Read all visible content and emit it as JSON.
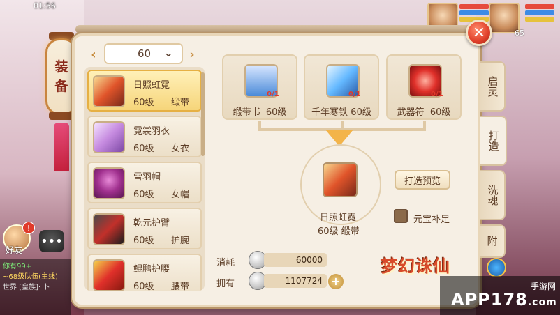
{
  "status": {
    "time": "01:56"
  },
  "hud": {
    "player_level": "65"
  },
  "lantern": {
    "title_chars": [
      "装",
      "备"
    ]
  },
  "left": {
    "friend_label": "好友",
    "friend_badge": "!",
    "chat_lines": [
      {
        "text": "你有99+",
        "color": "g"
      },
      {
        "text": "~68级队伍(主线)",
        "color": "y"
      },
      {
        "text": "世界 [皇族]· 卜",
        "color": "w"
      }
    ]
  },
  "level_select": {
    "value": "60"
  },
  "items": [
    {
      "name": "日照虹霓",
      "level": "60级",
      "type": "缎带",
      "selected": true,
      "icon": "ribbon-icon"
    },
    {
      "name": "霓裳羽衣",
      "level": "60级",
      "type": "女衣",
      "selected": false,
      "icon": "dress-icon"
    },
    {
      "name": "雪羽帽",
      "level": "60级",
      "type": "女帽",
      "selected": false,
      "icon": "hat-icon"
    },
    {
      "name": "乾元护臂",
      "level": "60级",
      "type": "护腕",
      "selected": false,
      "icon": "bracer-icon"
    },
    {
      "name": "鲲鹏护腰",
      "level": "60级",
      "type": "腰带",
      "selected": false,
      "icon": "belt-icon"
    }
  ],
  "materials": [
    {
      "name": "缎带书",
      "level": "60级",
      "count": "0/1",
      "icon": "scroll-icon",
      "color": "#4a8ad8"
    },
    {
      "name": "千年寒铁",
      "level": "60级",
      "count": "0/1",
      "icon": "ice-iron-icon",
      "color": "#63b8ff"
    },
    {
      "name": "武器符",
      "level": "60级",
      "count": "0/1",
      "icon": "weapon-talisman-icon",
      "color": "#e0302a"
    }
  ],
  "craft": {
    "name": "日照虹霓",
    "level_type": "60级 缎带",
    "preview_button": "打造预览",
    "yuanbao_label": "元宝补足"
  },
  "cost": {
    "consume_label": "消耗",
    "consume_value": "60000",
    "own_label": "拥有",
    "own_value": "1107724"
  },
  "tabs": [
    {
      "label": "启灵",
      "active": false
    },
    {
      "label": "打造",
      "active": true
    },
    {
      "label": "洗魂",
      "active": false
    },
    {
      "label": "附",
      "active": false
    }
  ],
  "branding": {
    "game_logo": "梦幻诛仙",
    "watermark_main": "APP178",
    "watermark_sub": ".com",
    "watermark_cn": "手游网"
  },
  "colors": {
    "accent": "#f3b44a",
    "panel": "#f6efe4",
    "close": "#e0402a"
  }
}
